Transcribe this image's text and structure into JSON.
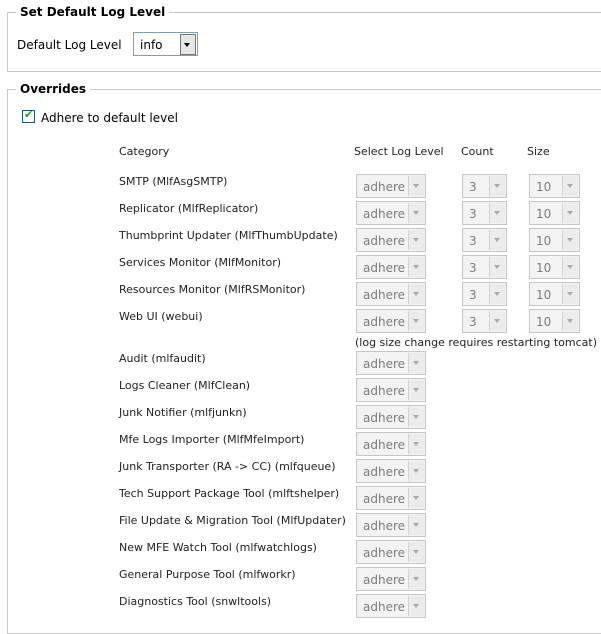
{
  "default_section": {
    "legend": "Set Default Log Level",
    "label": "Default Log Level",
    "select_value": "info"
  },
  "overrides_section": {
    "legend": "Overrides",
    "adhere_label": "Adhere to default level",
    "adhere_checked": true,
    "headers": {
      "category": "Category",
      "select_log_level": "Select Log Level",
      "count": "Count",
      "size": "Size"
    },
    "note": "(log size change requires restarting tomcat)",
    "rows_with_size": [
      {
        "category": "SMTP (MlfAsgSMTP)",
        "level": "adhere",
        "count": "3",
        "size": "10"
      },
      {
        "category": "Replicator (MlfReplicator)",
        "level": "adhere",
        "count": "3",
        "size": "10"
      },
      {
        "category": "Thumbprint Updater (MlfThumbUpdate)",
        "level": "adhere",
        "count": "3",
        "size": "10"
      },
      {
        "category": "Services Monitor (MlfMonitor)",
        "level": "adhere",
        "count": "3",
        "size": "10"
      },
      {
        "category": "Resources Monitor (MlfRSMonitor)",
        "level": "adhere",
        "count": "3",
        "size": "10"
      },
      {
        "category": "Web UI (webui)",
        "level": "adhere",
        "count": "3",
        "size": "10"
      }
    ],
    "rows_level_only": [
      {
        "category": "Audit (mlfaudit)",
        "level": "adhere"
      },
      {
        "category": "Logs Cleaner (MlfClean)",
        "level": "adhere"
      },
      {
        "category": "Junk Notifier (mlfjunkn)",
        "level": "adhere"
      },
      {
        "category": "Mfe Logs Importer (MlfMfeImport)",
        "level": "adhere"
      },
      {
        "category": "Junk Transporter (RA -> CC) (mlfqueue)",
        "level": "adhere"
      },
      {
        "category": "Tech Support Package Tool (mlftshelper)",
        "level": "adhere"
      },
      {
        "category": "File Update & Migration Tool (MlfUpdater)",
        "level": "adhere"
      },
      {
        "category": "New MFE Watch Tool (mlfwatchlogs)",
        "level": "adhere"
      },
      {
        "category": "General Purpose Tool (mlfworkr)",
        "level": "adhere"
      },
      {
        "category": "Diagnostics Tool (snwltools)",
        "level": "adhere"
      }
    ]
  },
  "colors": {
    "disabled_text": "#7d7d7d",
    "disabled_bg": "#f3f3f3",
    "border": "#c8c8c8",
    "check_green": "#21a121"
  }
}
